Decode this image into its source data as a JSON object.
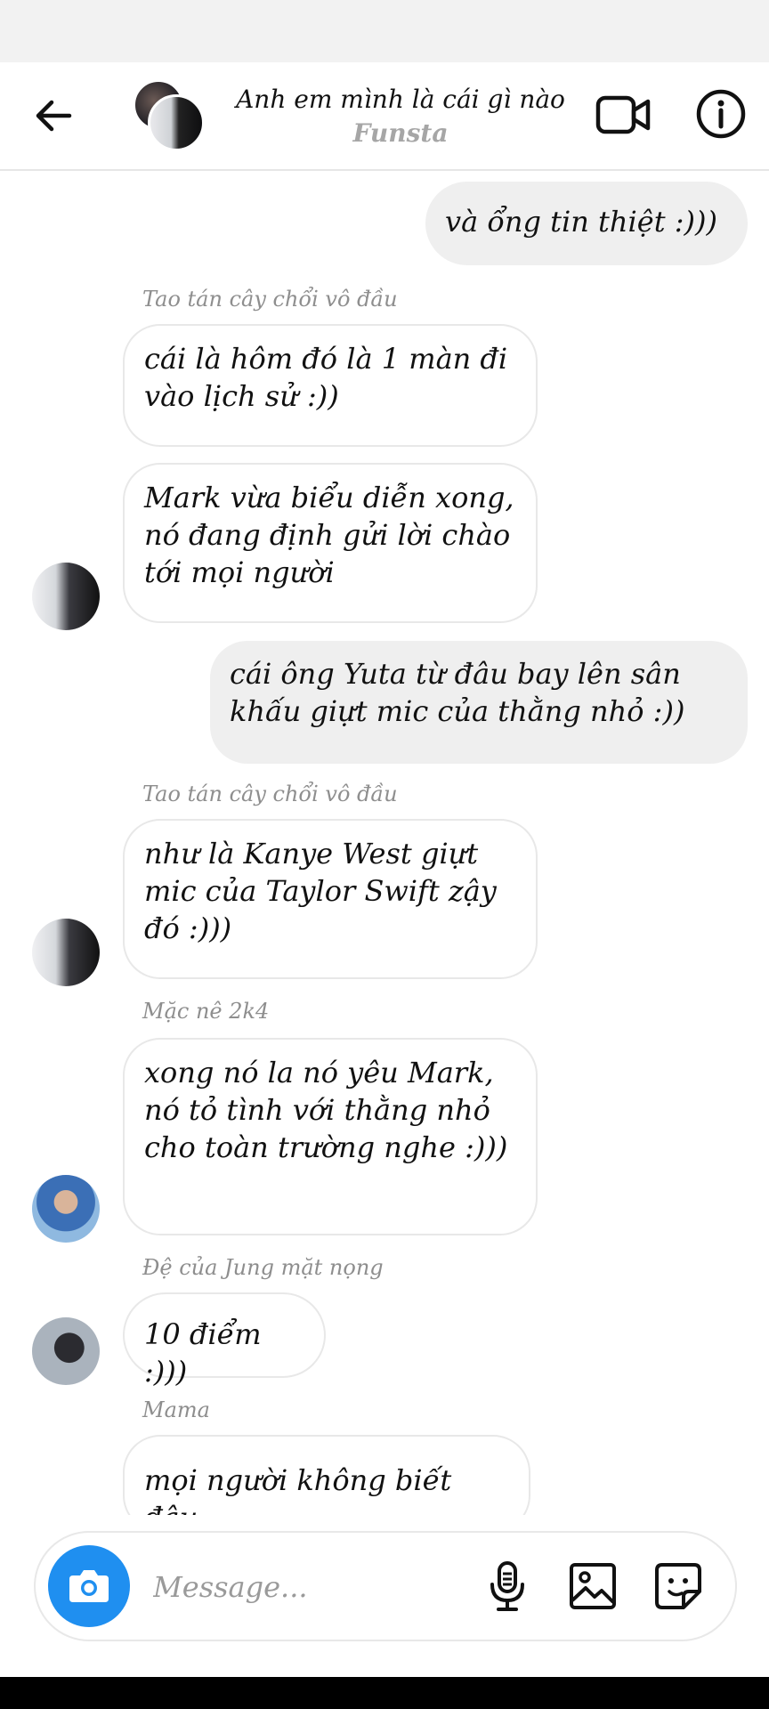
{
  "header": {
    "title": "Anh em mình là cái gì nào",
    "subtitle": "Funsta"
  },
  "messages": [
    {
      "direction": "out",
      "text": "và ổng tin thiệt :)))"
    },
    {
      "direction": "in",
      "sender": "Tao tán cây chổi vô đầu",
      "text": "cái là hôm đó là 1 màn đi vào lịch sử :))"
    },
    {
      "direction": "in",
      "text": "Mark vừa biểu diễn xong, nó đang định gửi lời chào tới mọi người"
    },
    {
      "direction": "out",
      "text": "cái ông Yuta từ đâu bay lên sân khấu giựt mic của thằng nhỏ :))"
    },
    {
      "direction": "in",
      "sender": "Tao tán cây chổi vô đầu",
      "text": "như là Kanye West giựt mic của Taylor Swift zậy đó :)))"
    },
    {
      "direction": "in",
      "sender": "Mặc nê 2k4",
      "text": "xong nó la nó yêu Mark, nó tỏ tình với thằng nhỏ cho toàn trường nghe :)))"
    },
    {
      "direction": "in",
      "sender": "Đệ của Jung mặt nọng",
      "text": "10 điểm :)))"
    },
    {
      "direction": "in",
      "sender": "Mama",
      "text": "mọi người không biết đâu"
    }
  ],
  "composer": {
    "placeholder": "Message..."
  },
  "colors": {
    "camera_button": "#1f8ff0",
    "outgoing_bubble": "#efefef",
    "incoming_border": "#e8e8e8",
    "sender_name": "#8e8e8e"
  },
  "icons": [
    "back-arrow-icon",
    "video-call-icon",
    "info-icon",
    "camera-icon",
    "microphone-icon",
    "gallery-icon",
    "sticker-icon"
  ]
}
